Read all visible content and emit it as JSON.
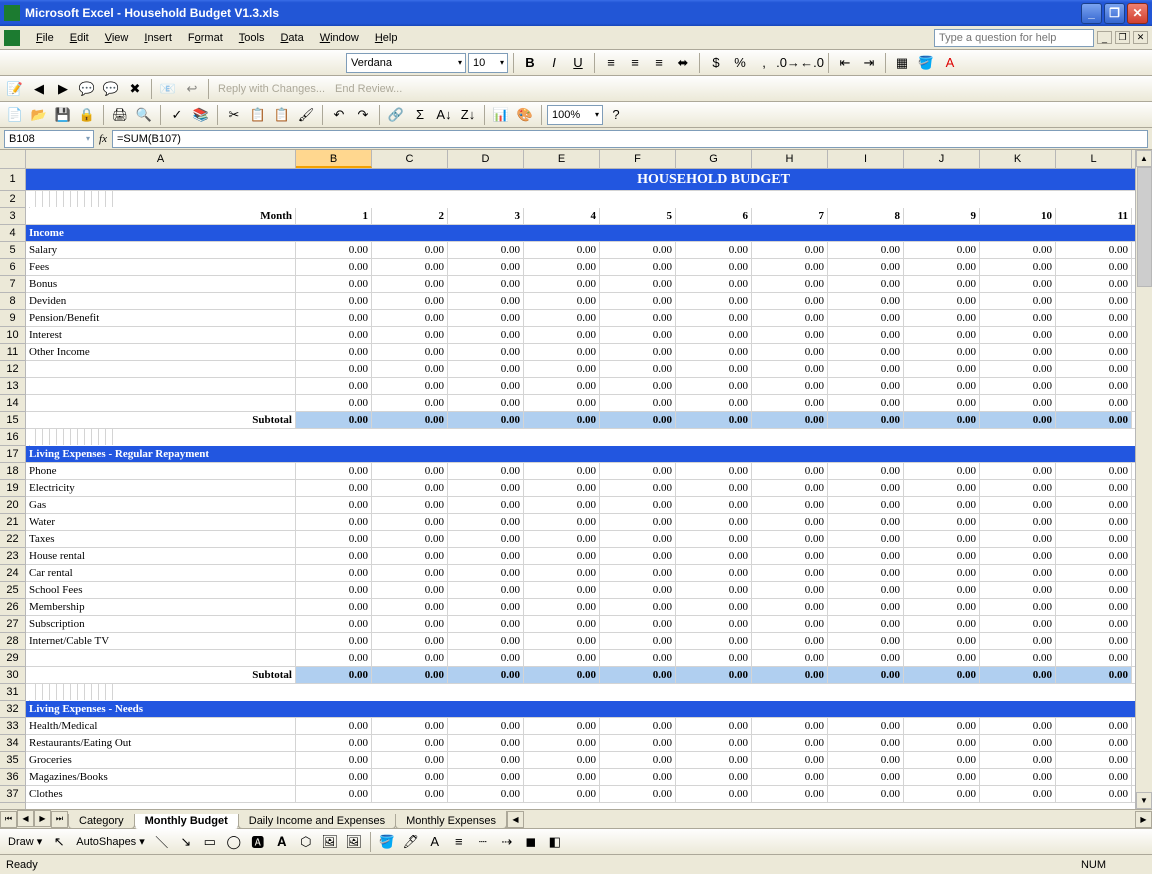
{
  "window": {
    "title": "Microsoft Excel - Household Budget V1.3.xls"
  },
  "menus": {
    "file": "File",
    "edit": "Edit",
    "view": "View",
    "insert": "Insert",
    "format": "Format",
    "tools": "Tools",
    "data": "Data",
    "window": "Window",
    "help": "Help"
  },
  "help_placeholder": "Type a question for help",
  "format_bar": {
    "font": "Verdana",
    "size": "10",
    "zoom": "100%"
  },
  "review_bar": {
    "reply": "Reply with Changes...",
    "end": "End Review..."
  },
  "formula_bar": {
    "cell_ref": "B108",
    "formula": "=SUM(B107)"
  },
  "sheet": {
    "title": "HOUSEHOLD BUDGET",
    "month_label": "Month",
    "columns": [
      "A",
      "B",
      "C",
      "D",
      "E",
      "F",
      "G",
      "H",
      "I",
      "J",
      "K",
      "L"
    ],
    "months": [
      "1",
      "2",
      "3",
      "4",
      "5",
      "6",
      "7",
      "8",
      "9",
      "10",
      "11"
    ],
    "value": "0.00",
    "subtotal_label": "Subtotal",
    "sections": {
      "income": {
        "title": "Income",
        "rows": [
          "Salary",
          "Fees",
          "Bonus",
          "Deviden",
          "Pension/Benefit",
          "Interest",
          "Other Income",
          "",
          "",
          ""
        ]
      },
      "living_regular": {
        "title": "Living Expenses - Regular Repayment",
        "rows": [
          "Phone",
          "Electricity",
          "Gas",
          "Water",
          "Taxes",
          "House rental",
          "Car rental",
          "School Fees",
          "Membership",
          "Subscription",
          "Internet/Cable TV",
          ""
        ]
      },
      "living_needs": {
        "title": "Living Expenses - Needs",
        "rows": [
          "Health/Medical",
          "Restaurants/Eating Out",
          "Groceries",
          "Magazines/Books",
          "Clothes"
        ]
      }
    }
  },
  "tabs": {
    "nav": [
      "⏮",
      "◀",
      "▶",
      "⏭"
    ],
    "items": [
      "Category",
      "Monthly Budget",
      "Daily Income and Expenses",
      "Monthly Expenses"
    ],
    "active": 1
  },
  "draw": {
    "draw": "Draw",
    "autoshapes": "AutoShapes"
  },
  "status": {
    "ready": "Ready",
    "num": "NUM"
  }
}
